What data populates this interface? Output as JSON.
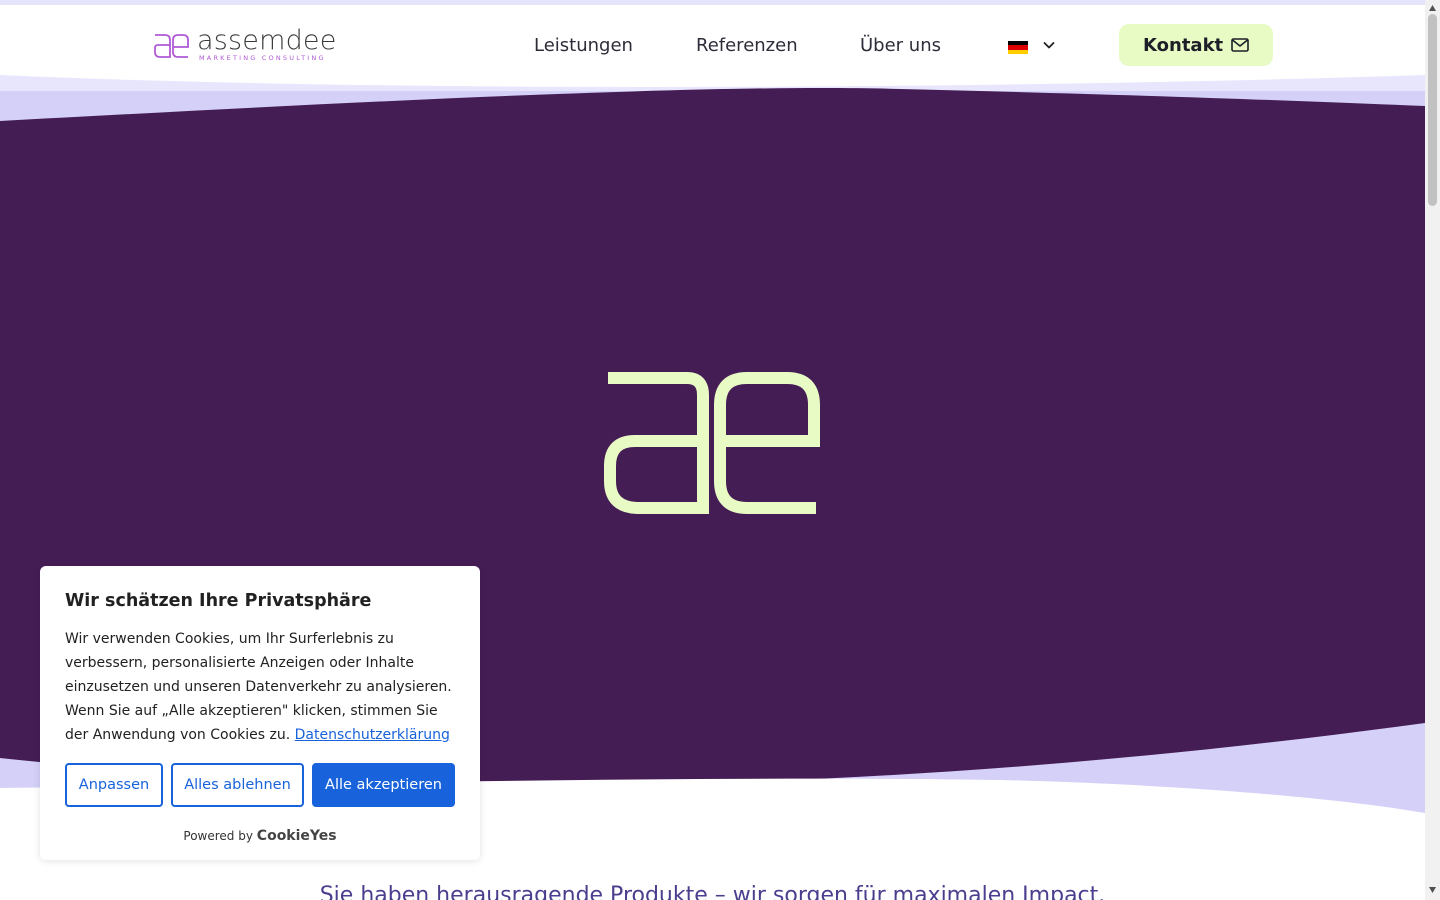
{
  "brand": {
    "name": "assemdee",
    "tagline": "MARKETING CONSULTING",
    "logo_icon": "ae-monogram-icon",
    "colors": {
      "primary_purple": "#451d55",
      "accent_lime": "#e8fbc4",
      "logo_violet": "#b05ad6",
      "wave_lavender": "#d4d0f7"
    }
  },
  "nav": {
    "items": [
      {
        "label": "Leistungen"
      },
      {
        "label": "Referenzen"
      },
      {
        "label": "Über uns"
      }
    ],
    "language": {
      "icon": "german-flag-icon",
      "chevron": "chevron-down-icon"
    },
    "contact_label": "Kontakt",
    "contact_icon": "mail-icon"
  },
  "hero": {
    "center_icon": "ae-monogram-icon",
    "teaser": "Sie haben herausragende Produkte – wir sorgen für maximalen Impact."
  },
  "cookie_banner": {
    "title": "Wir schätzen Ihre Privatsphäre",
    "body": "Wir verwenden Cookies, um Ihr Surferlebnis zu verbessern, personalisierte Anzeigen oder Inhalte einzusetzen und unseren Datenverkehr zu analysieren. Wenn Sie auf „Alle akzeptieren\" klicken, stimmen Sie der Anwendung von Cookies zu.",
    "privacy_link": "Datenschutzerklärung",
    "customize_label": "Anpassen",
    "reject_label": "Alles ablehnen",
    "accept_label": "Alle akzeptieren",
    "powered_by": "Powered by",
    "powered_brand": "CookieYes",
    "accent_color": "#1863dc"
  }
}
